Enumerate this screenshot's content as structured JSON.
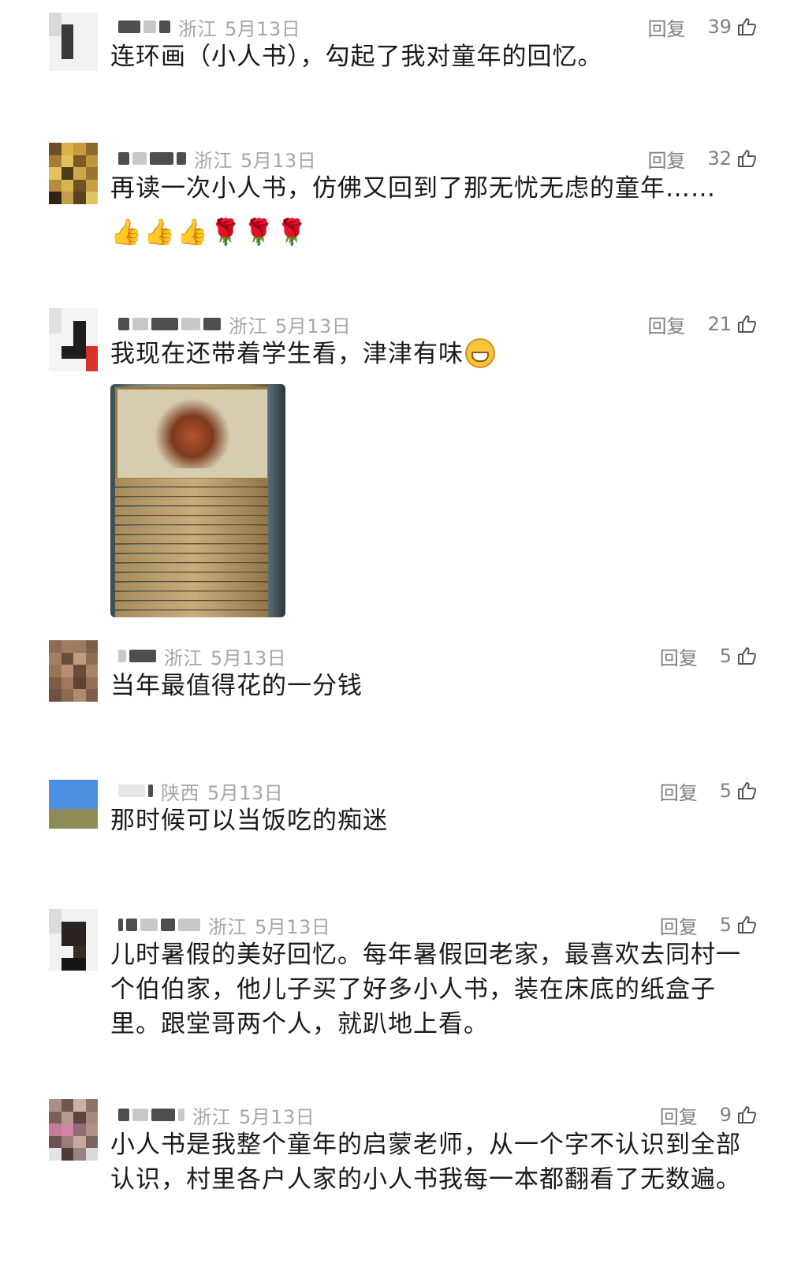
{
  "reply_label": "回复",
  "comments": [
    {
      "region": "浙江",
      "date": "5月13日",
      "likes": "39",
      "text": "连环画（小人书），勾起了我对童年的回忆。"
    },
    {
      "region": "浙江",
      "date": "5月13日",
      "likes": "32",
      "text": "再读一次小人书，仿佛又回到了那无忧无虑的童年……",
      "emojis": [
        "👍",
        "👍",
        "👍",
        "🌹",
        "🌹",
        "🌹"
      ]
    },
    {
      "region": "浙江",
      "date": "5月13日",
      "likes": "21",
      "text": "我现在还带着学生看，津津有味"
    },
    {
      "region": "浙江",
      "date": "5月13日",
      "likes": "5",
      "text": "当年最值得花的一分钱"
    },
    {
      "region": "陕西",
      "date": "5月13日",
      "likes": "5",
      "text": "那时候可以当饭吃的痴迷"
    },
    {
      "region": "浙江",
      "date": "5月13日",
      "likes": "5",
      "text": "儿时暑假的美好回忆。每年暑假回老家，最喜欢去同村一个伯伯家，他儿子买了好多小人书，装在床底的纸盒子里。跟堂哥两个人，就趴地上看。"
    },
    {
      "region": "浙江",
      "date": "5月13日",
      "likes": "9",
      "text": "小人书是我整个童年的启蒙老师，从一个字不认识到全部认识，村里各户人家的小人书我每一本都翻看了无数遍。"
    }
  ]
}
